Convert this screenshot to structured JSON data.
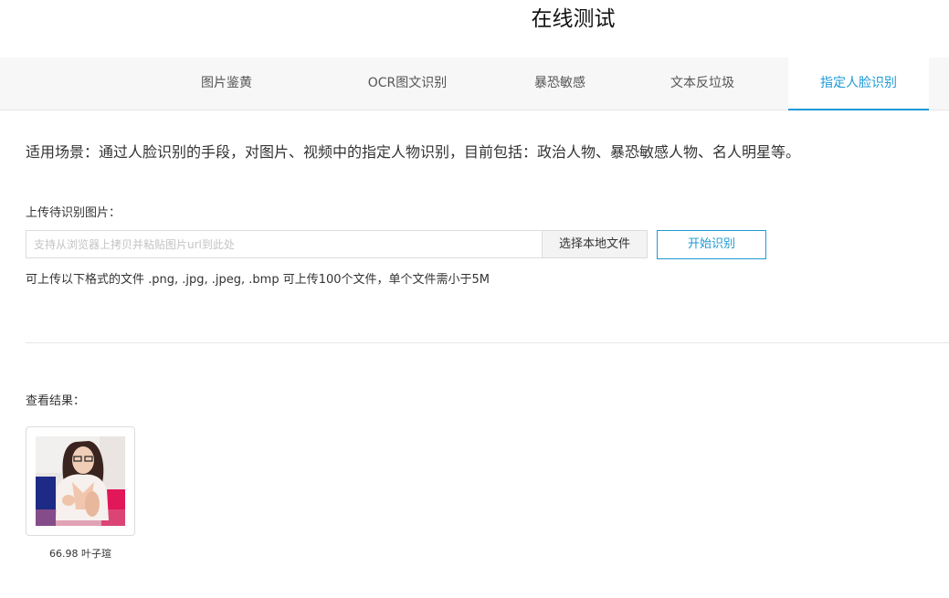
{
  "header": {
    "title": "在线测试"
  },
  "tabs": [
    {
      "label": "图片鉴黄",
      "active": false
    },
    {
      "label": "OCR图文识别",
      "active": false
    },
    {
      "label": "暴恐敏感",
      "active": false
    },
    {
      "label": "文本反垃圾",
      "active": false
    },
    {
      "label": "指定人脸识别",
      "active": true
    }
  ],
  "main": {
    "scenario": "适用场景：通过人脸识别的手段，对图片、视频中的指定人物识别，目前包括：政治人物、暴恐敏感人物、名人明星等。",
    "upload_label": "上传待识别图片：",
    "url_placeholder": "支持从浏览器上拷贝并粘贴图片url到此处",
    "browse_label": "选择本地文件",
    "start_label": "开始识别",
    "format_note": "可上传以下格式的文件 .png, .jpg, .jpeg, .bmp 可上传100个文件，单个文件需小于5M",
    "results_label": "查看结果：",
    "results": [
      {
        "score": "66.98",
        "name": "叶子瑄"
      }
    ]
  },
  "colors": {
    "accent": "#1f9ad6",
    "tab_bg": "#f7f7f7",
    "border": "#dcdcdc"
  }
}
